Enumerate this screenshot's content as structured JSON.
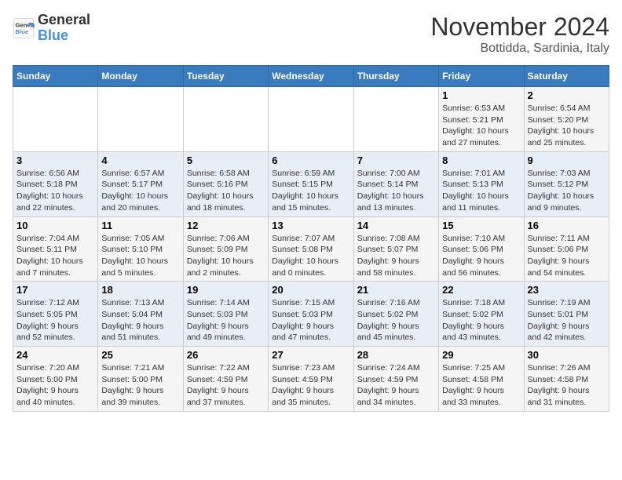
{
  "logo": {
    "line1": "General",
    "line2": "Blue"
  },
  "title": "November 2024",
  "subtitle": "Bottidda, Sardinia, Italy",
  "days_of_week": [
    "Sunday",
    "Monday",
    "Tuesday",
    "Wednesday",
    "Thursday",
    "Friday",
    "Saturday"
  ],
  "weeks": [
    [
      {
        "day": "",
        "info": ""
      },
      {
        "day": "",
        "info": ""
      },
      {
        "day": "",
        "info": ""
      },
      {
        "day": "",
        "info": ""
      },
      {
        "day": "",
        "info": ""
      },
      {
        "day": "1",
        "info": "Sunrise: 6:53 AM\nSunset: 5:21 PM\nDaylight: 10 hours\nand 27 minutes."
      },
      {
        "day": "2",
        "info": "Sunrise: 6:54 AM\nSunset: 5:20 PM\nDaylight: 10 hours\nand 25 minutes."
      }
    ],
    [
      {
        "day": "3",
        "info": "Sunrise: 6:56 AM\nSunset: 5:18 PM\nDaylight: 10 hours\nand 22 minutes."
      },
      {
        "day": "4",
        "info": "Sunrise: 6:57 AM\nSunset: 5:17 PM\nDaylight: 10 hours\nand 20 minutes."
      },
      {
        "day": "5",
        "info": "Sunrise: 6:58 AM\nSunset: 5:16 PM\nDaylight: 10 hours\nand 18 minutes."
      },
      {
        "day": "6",
        "info": "Sunrise: 6:59 AM\nSunset: 5:15 PM\nDaylight: 10 hours\nand 15 minutes."
      },
      {
        "day": "7",
        "info": "Sunrise: 7:00 AM\nSunset: 5:14 PM\nDaylight: 10 hours\nand 13 minutes."
      },
      {
        "day": "8",
        "info": "Sunrise: 7:01 AM\nSunset: 5:13 PM\nDaylight: 10 hours\nand 11 minutes."
      },
      {
        "day": "9",
        "info": "Sunrise: 7:03 AM\nSunset: 5:12 PM\nDaylight: 10 hours\nand 9 minutes."
      }
    ],
    [
      {
        "day": "10",
        "info": "Sunrise: 7:04 AM\nSunset: 5:11 PM\nDaylight: 10 hours\nand 7 minutes."
      },
      {
        "day": "11",
        "info": "Sunrise: 7:05 AM\nSunset: 5:10 PM\nDaylight: 10 hours\nand 5 minutes."
      },
      {
        "day": "12",
        "info": "Sunrise: 7:06 AM\nSunset: 5:09 PM\nDaylight: 10 hours\nand 2 minutes."
      },
      {
        "day": "13",
        "info": "Sunrise: 7:07 AM\nSunset: 5:08 PM\nDaylight: 10 hours\nand 0 minutes."
      },
      {
        "day": "14",
        "info": "Sunrise: 7:08 AM\nSunset: 5:07 PM\nDaylight: 9 hours\nand 58 minutes."
      },
      {
        "day": "15",
        "info": "Sunrise: 7:10 AM\nSunset: 5:06 PM\nDaylight: 9 hours\nand 56 minutes."
      },
      {
        "day": "16",
        "info": "Sunrise: 7:11 AM\nSunset: 5:06 PM\nDaylight: 9 hours\nand 54 minutes."
      }
    ],
    [
      {
        "day": "17",
        "info": "Sunrise: 7:12 AM\nSunset: 5:05 PM\nDaylight: 9 hours\nand 52 minutes."
      },
      {
        "day": "18",
        "info": "Sunrise: 7:13 AM\nSunset: 5:04 PM\nDaylight: 9 hours\nand 51 minutes."
      },
      {
        "day": "19",
        "info": "Sunrise: 7:14 AM\nSunset: 5:03 PM\nDaylight: 9 hours\nand 49 minutes."
      },
      {
        "day": "20",
        "info": "Sunrise: 7:15 AM\nSunset: 5:03 PM\nDaylight: 9 hours\nand 47 minutes."
      },
      {
        "day": "21",
        "info": "Sunrise: 7:16 AM\nSunset: 5:02 PM\nDaylight: 9 hours\nand 45 minutes."
      },
      {
        "day": "22",
        "info": "Sunrise: 7:18 AM\nSunset: 5:02 PM\nDaylight: 9 hours\nand 43 minutes."
      },
      {
        "day": "23",
        "info": "Sunrise: 7:19 AM\nSunset: 5:01 PM\nDaylight: 9 hours\nand 42 minutes."
      }
    ],
    [
      {
        "day": "24",
        "info": "Sunrise: 7:20 AM\nSunset: 5:00 PM\nDaylight: 9 hours\nand 40 minutes."
      },
      {
        "day": "25",
        "info": "Sunrise: 7:21 AM\nSunset: 5:00 PM\nDaylight: 9 hours\nand 39 minutes."
      },
      {
        "day": "26",
        "info": "Sunrise: 7:22 AM\nSunset: 4:59 PM\nDaylight: 9 hours\nand 37 minutes."
      },
      {
        "day": "27",
        "info": "Sunrise: 7:23 AM\nSunset: 4:59 PM\nDaylight: 9 hours\nand 35 minutes."
      },
      {
        "day": "28",
        "info": "Sunrise: 7:24 AM\nSunset: 4:59 PM\nDaylight: 9 hours\nand 34 minutes."
      },
      {
        "day": "29",
        "info": "Sunrise: 7:25 AM\nSunset: 4:58 PM\nDaylight: 9 hours\nand 33 minutes."
      },
      {
        "day": "30",
        "info": "Sunrise: 7:26 AM\nSunset: 4:58 PM\nDaylight: 9 hours\nand 31 minutes."
      }
    ]
  ]
}
